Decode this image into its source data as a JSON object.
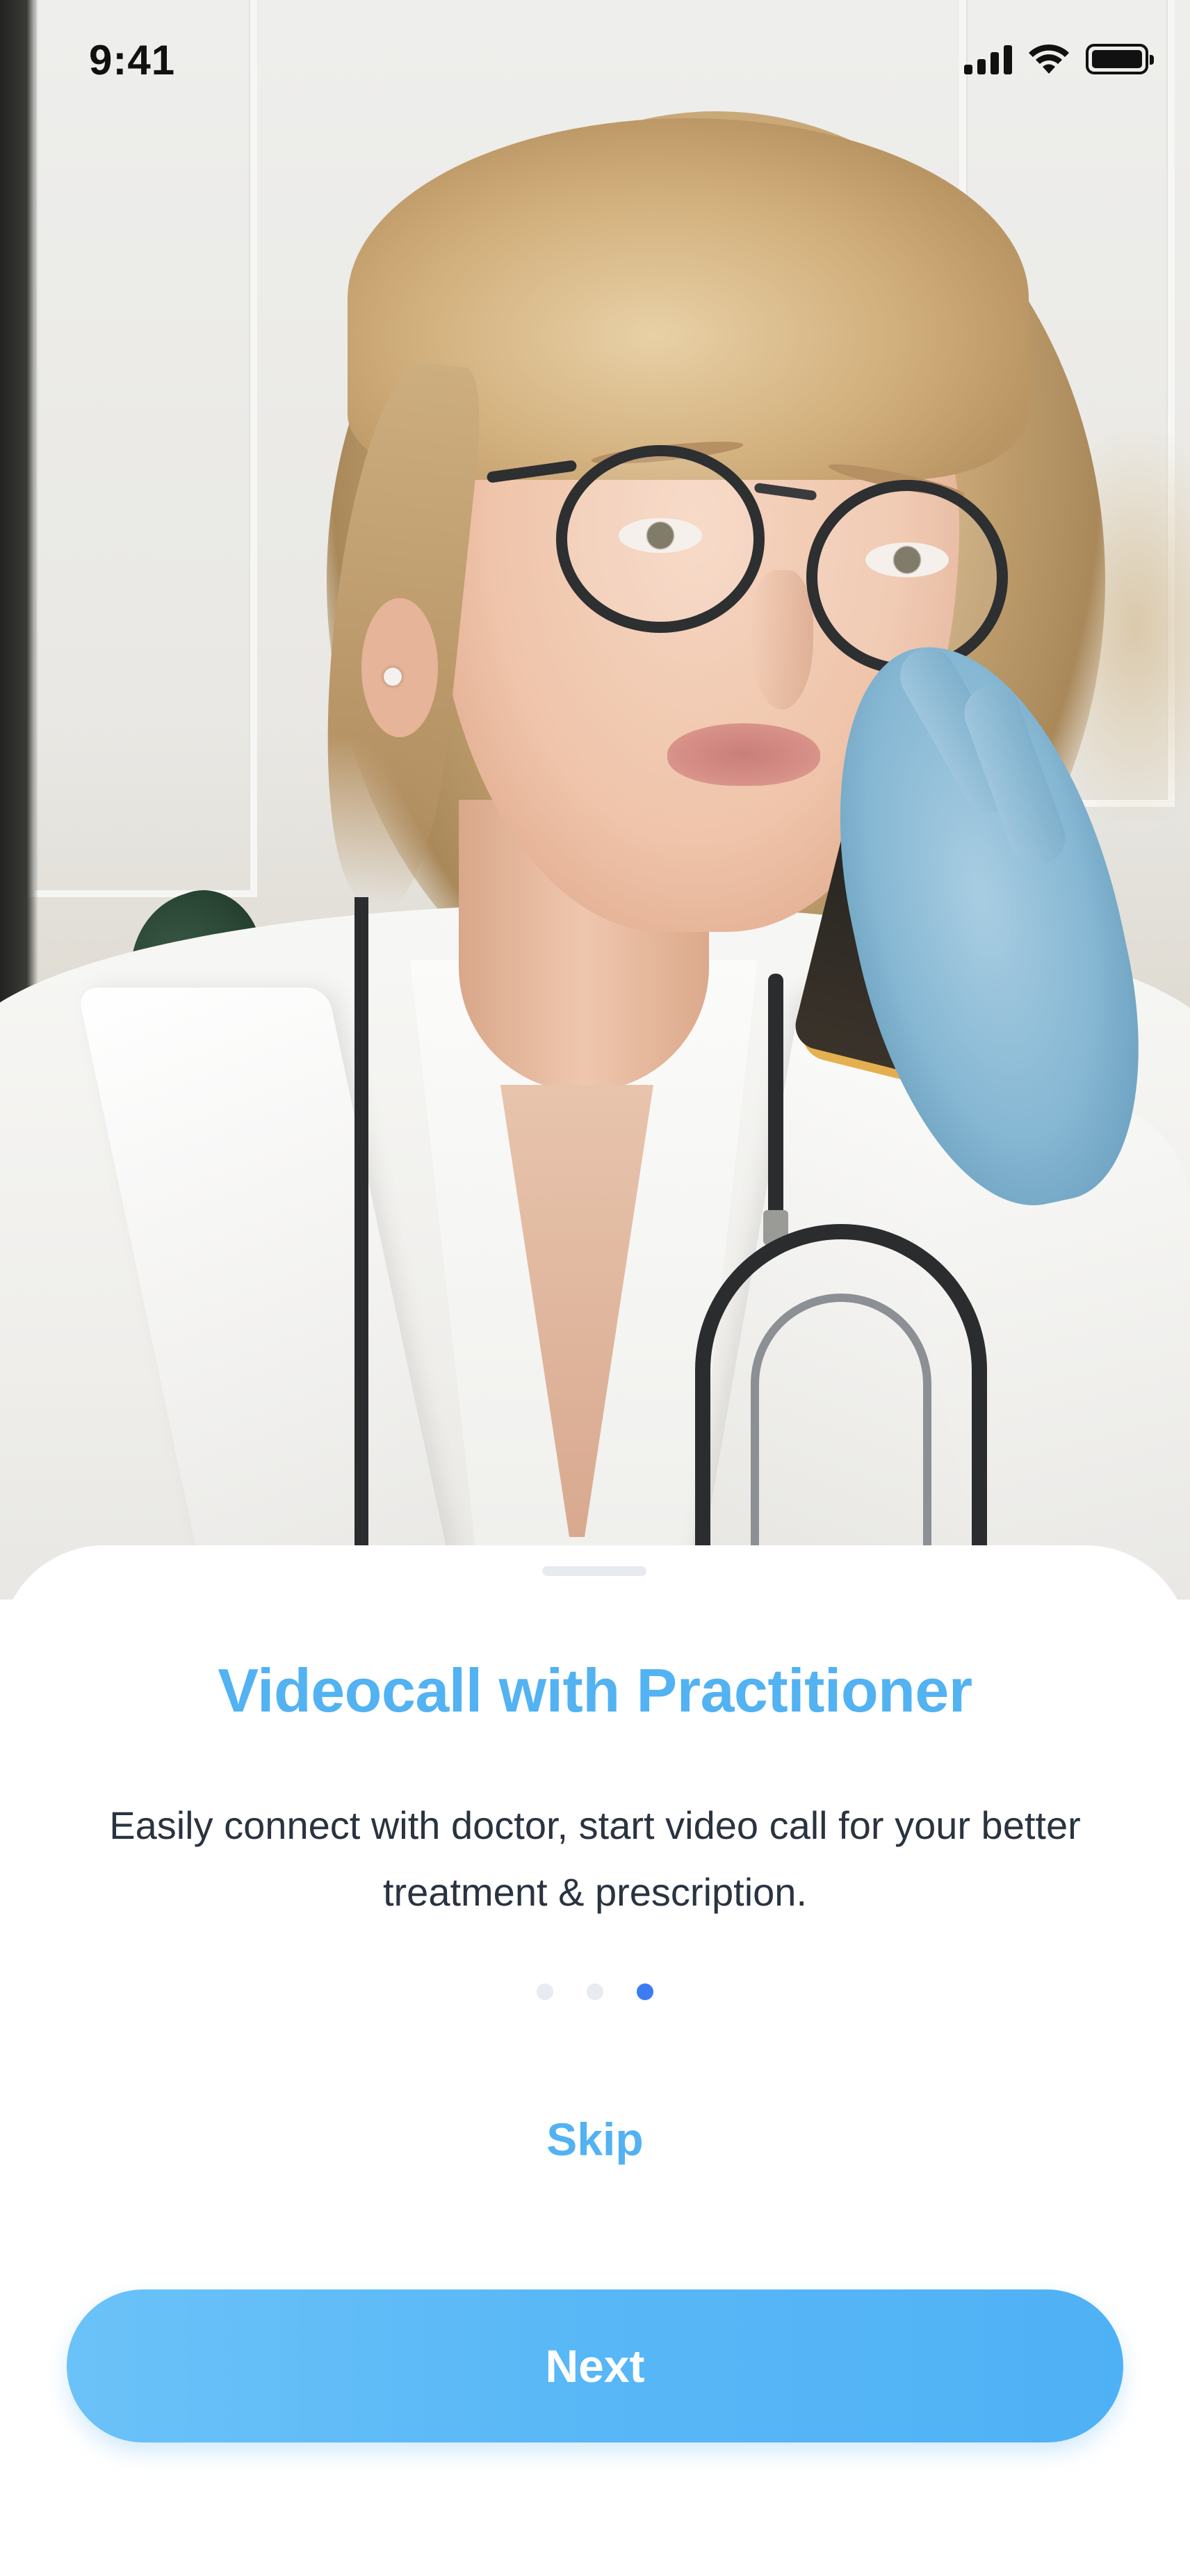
{
  "status_bar": {
    "time": "9:41",
    "icons": [
      "cellular-signal-icon",
      "wifi-icon",
      "battery-icon"
    ]
  },
  "hero": {
    "image": "doctor-on-phone-photo"
  },
  "onboarding": {
    "title": "Videocall with Practitioner",
    "description": "Easily connect with doctor, start video call for your better treatment & prescription.",
    "page_indicator": {
      "total": 3,
      "current": 3
    },
    "skip_label": "Skip",
    "next_label": "Next"
  },
  "colors": {
    "accent": "#52B2F2",
    "active_dot": "#3C7CF3",
    "inactive_dot": "#E8EBF1",
    "text": "#2A3340"
  }
}
